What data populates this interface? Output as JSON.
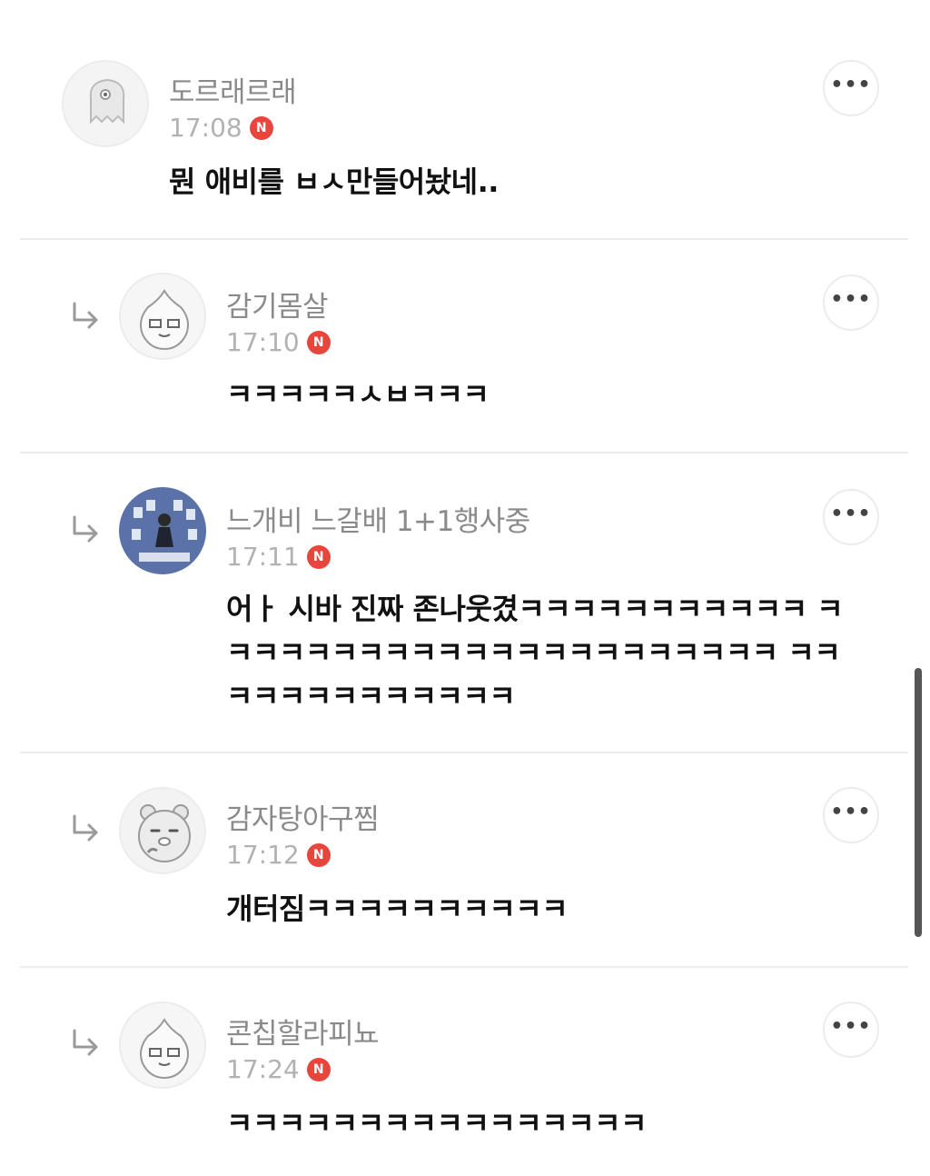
{
  "comments": [
    {
      "author": "도르래르래",
      "time": "17:08",
      "badge": "N",
      "text": "뭔 애비를 ㅂㅅ만들어놨네..",
      "more": "•••",
      "avatar_icon": "ghost-character-avatar"
    },
    {
      "author": "감기몸살",
      "time": "17:10",
      "badge": "N",
      "text": "ㅋㅋㅋㅋㅋㅅㅂㅋㅋㅋ",
      "more": "•••",
      "avatar_icon": "apeach-character-avatar"
    },
    {
      "author": "느개비 느갈배 1+1행사중",
      "time": "17:11",
      "badge": "N",
      "text": "어ㅏ 시바 진짜 존나웃겼ㅋㅋㅋㅋㅋㅋㅋㅋㅋㅋㅋ ㅋㅋㅋㅋㅋㅋㅋㅋㅋㅋㅋㅋㅋㅋㅋㅋㅋㅋㅋㅋㅋㅋ ㅋㅋㅋㅋㅋㅋㅋㅋㅋㅋㅋㅋㅋ",
      "more": "•••",
      "avatar_icon": "photo-avatar"
    },
    {
      "author": "감자탕아구찜",
      "time": "17:12",
      "badge": "N",
      "text": "개터짐ㅋㅋㅋㅋㅋㅋㅋㅋㅋㅋ",
      "more": "•••",
      "avatar_icon": "ryan-character-avatar"
    },
    {
      "author": "콘칩할라피뇨",
      "time": "17:24",
      "badge": "N",
      "text": "ㅋㅋㅋㅋㅋㅋㅋㅋㅋㅋㅋㅋㅋㅋㅋㅋ",
      "more": "•••",
      "avatar_icon": "apeach-character-avatar"
    }
  ]
}
